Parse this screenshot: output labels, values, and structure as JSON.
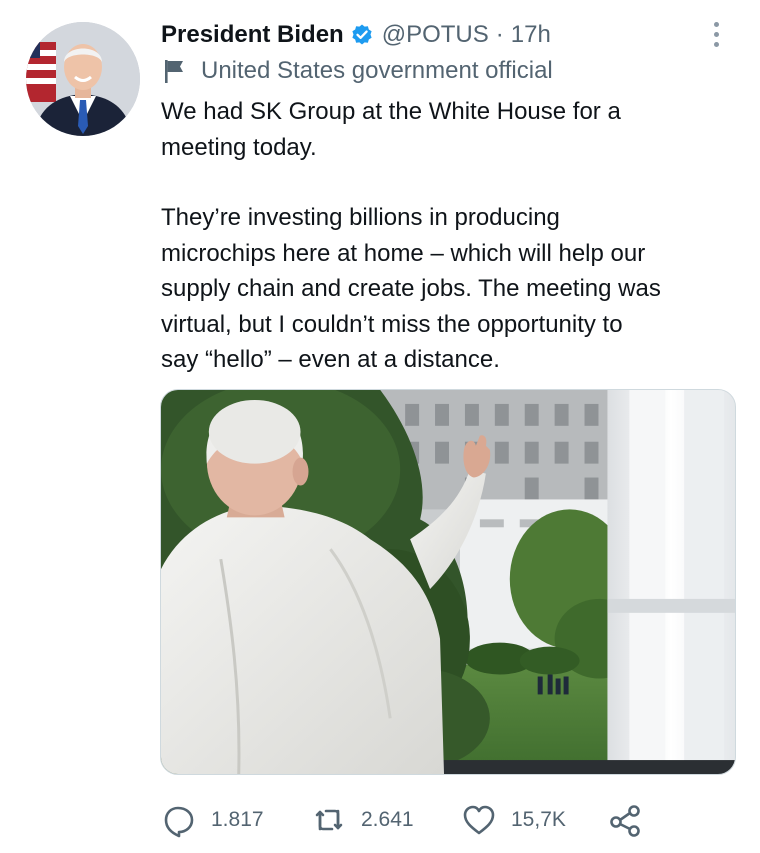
{
  "tweet": {
    "author_name": "President Biden",
    "handle": "@POTUS",
    "separator": "·",
    "time": "17h",
    "affiliation": "United States government official",
    "paragraphs": [
      "We had SK Group at the White House for a\nmeeting today.",
      "They’re investing billions in producing\nmicrochips here at home – which will help our\nsupply chain and create jobs. The meeting was\nvirtual, but I couldn’t miss the opportunity to\nsay “hello” – even at a distance."
    ],
    "verified_icon": "verified-badge-icon",
    "media_alt_icon": "photo"
  },
  "actions": {
    "replies": "1.817",
    "retweets": "2.641",
    "likes": "15,7K"
  },
  "colors": {
    "accent": "#1d9bf0",
    "secondary_text": "#536471",
    "primary_text": "#0f1419"
  }
}
